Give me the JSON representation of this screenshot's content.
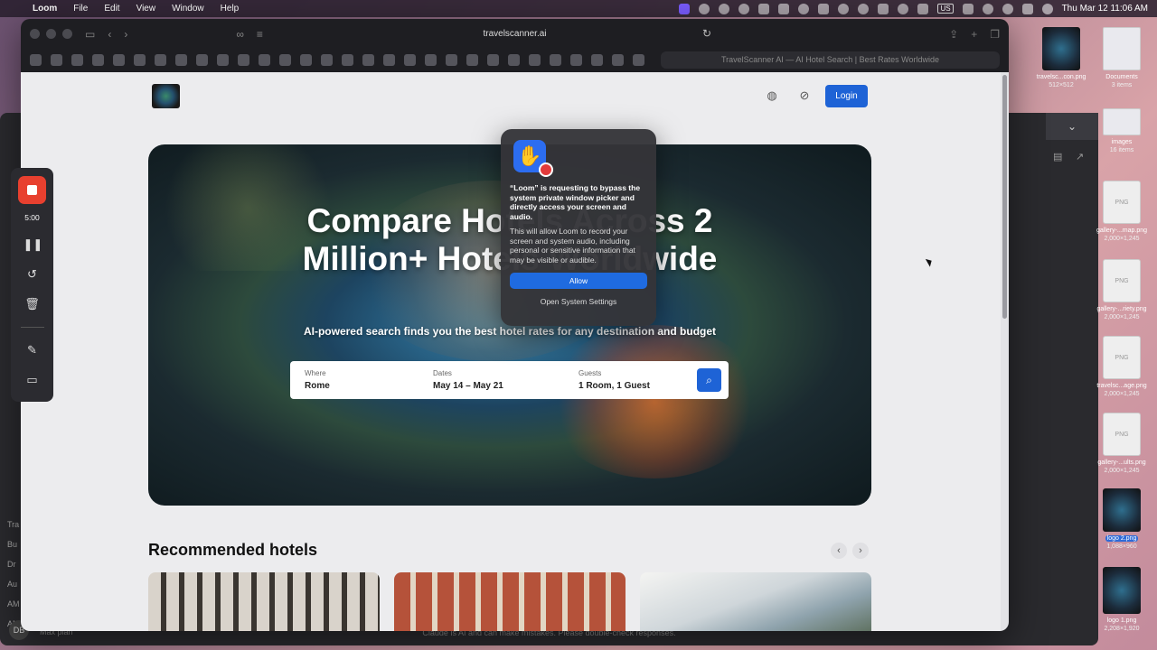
{
  "menubar": {
    "app": "Loom",
    "menus": [
      "File",
      "Edit",
      "View",
      "Window",
      "Help"
    ],
    "datetime": "Thu Mar 12  11:06 AM",
    "input_source": "US"
  },
  "browser": {
    "url": "travelscanner.ai",
    "tab_title": "TravelScanner AI — AI Hotel Search | Best Rates Worldwide"
  },
  "site": {
    "login_label": "Login",
    "hero_title": "Compare Hotels Across 2 Million+ Hotels Worldwide",
    "hero_subtitle": "AI-powered search finds you the best hotel rates for any destination and budget",
    "search": {
      "where_label": "Where",
      "where_value": "Rome",
      "dates_label": "Dates",
      "dates_value": "May 14 – May 21",
      "guests_label": "Guests",
      "guests_value": "1 Room, 1 Guest"
    },
    "recommended_title": "Recommended hotels"
  },
  "dialog": {
    "title": "“Loom” is requesting to bypass the system private window picker and directly access your screen and audio.",
    "body": "This will allow Loom to record your screen and system audio, including personal or sensitive information that may be visible or audible.",
    "allow_label": "Allow",
    "settings_label": "Open System Settings"
  },
  "loom": {
    "timer": "5:00"
  },
  "background_app": {
    "footer_text": "Claude is AI and can make mistakes. Please double-check responses.",
    "avatar_initials": "DB",
    "plan": "Max plan",
    "side_items": [
      "Tra",
      "Bu",
      "Dr",
      "Au",
      "AM",
      "AM"
    ]
  },
  "desktop_files": [
    {
      "name": "Documents",
      "meta": "3 items",
      "kind": "folder"
    },
    {
      "name": "travelsc...con.png",
      "meta": "512×512",
      "kind": "image"
    },
    {
      "name": "images",
      "meta": "16 items",
      "kind": "folder"
    },
    {
      "name": "gallery-...map.png",
      "meta": "2,000×1,245",
      "kind": "file"
    },
    {
      "name": "gallery-...riety.png",
      "meta": "2,000×1,245",
      "kind": "file"
    },
    {
      "name": "travelsc...age.png",
      "meta": "2,000×1,245",
      "kind": "file"
    },
    {
      "name": "gallery-...ults.png",
      "meta": "2,000×1,245",
      "kind": "file"
    },
    {
      "name": "logo 2.png",
      "meta": "1,088×960",
      "kind": "image"
    },
    {
      "name": "logo 1.png",
      "meta": "2,208×1,920",
      "kind": "image"
    }
  ]
}
